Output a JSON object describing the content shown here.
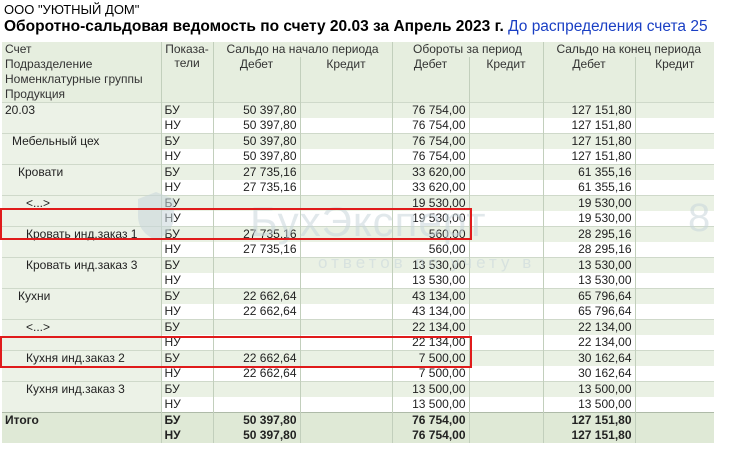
{
  "header": {
    "org": "ООО \"УЮТНЫЙ ДОМ\"",
    "title": "Оборотно-сальдовая ведомость по счету 20.03 за Апрель 2023 г.",
    "link": "До распределения счета 25"
  },
  "columns": {
    "left": [
      "Счет",
      "Подразделение",
      "Номенклатурные группы",
      "Продукция"
    ],
    "pokazateli": "Показа-\nтели",
    "saldo_start": "Сальдо на начало периода",
    "turnover": "Обороты за период",
    "saldo_end": "Сальдо на конец периода",
    "debet": "Дебет",
    "kredit": "Кредит"
  },
  "rows": [
    {
      "name": "20.03",
      "indent": 0,
      "bu": {
        "sd": "50 397,80",
        "od": "76 754,00",
        "ed": "127 151,80"
      },
      "nu": {
        "sd": "50 397,80",
        "od": "76 754,00",
        "ed": "127 151,80"
      }
    },
    {
      "name": "Мебельный цех",
      "indent": 1,
      "bu": {
        "sd": "50 397,80",
        "od": "76 754,00",
        "ed": "127 151,80"
      },
      "nu": {
        "sd": "50 397,80",
        "od": "76 754,00",
        "ed": "127 151,80"
      }
    },
    {
      "name": "Кровати",
      "indent": 2,
      "bu": {
        "sd": "27 735,16",
        "od": "33 620,00",
        "ed": "61 355,16"
      },
      "nu": {
        "sd": "27 735,16",
        "od": "33 620,00",
        "ed": "61 355,16"
      }
    },
    {
      "name": "<...>",
      "indent": 3,
      "bu": {
        "sd": "",
        "od": "19 530,00",
        "ed": "19 530,00"
      },
      "nu": {
        "sd": "",
        "od": "19 530,00",
        "ed": "19 530,00"
      }
    },
    {
      "name": "Кровать инд.заказ 1",
      "indent": 3,
      "bu": {
        "sd": "27 735,16",
        "od": "560,00",
        "ed": "28 295,16"
      },
      "nu": {
        "sd": "27 735,16",
        "od": "560,00",
        "ed": "28 295,16"
      }
    },
    {
      "name": "Кровать инд.заказ 3",
      "indent": 3,
      "bu": {
        "sd": "",
        "od": "13 530,00",
        "ed": "13 530,00"
      },
      "nu": {
        "sd": "",
        "od": "13 530,00",
        "ed": "13 530,00"
      }
    },
    {
      "name": "Кухни",
      "indent": 2,
      "bu": {
        "sd": "22 662,64",
        "od": "43 134,00",
        "ed": "65 796,64"
      },
      "nu": {
        "sd": "22 662,64",
        "od": "43 134,00",
        "ed": "65 796,64"
      }
    },
    {
      "name": "<...>",
      "indent": 3,
      "bu": {
        "sd": "",
        "od": "22 134,00",
        "ed": "22 134,00"
      },
      "nu": {
        "sd": "",
        "od": "22 134,00",
        "ed": "22 134,00"
      }
    },
    {
      "name": "Кухня инд.заказ 2",
      "indent": 3,
      "bu": {
        "sd": "22 662,64",
        "od": "7 500,00",
        "ed": "30 162,64"
      },
      "nu": {
        "sd": "22 662,64",
        "od": "7 500,00",
        "ed": "30 162,64"
      }
    },
    {
      "name": "Кухня инд.заказ 3",
      "indent": 3,
      "bu": {
        "sd": "",
        "od": "13 500,00",
        "ed": "13 500,00"
      },
      "nu": {
        "sd": "",
        "od": "13 500,00",
        "ed": "13 500,00"
      }
    }
  ],
  "total": {
    "label": "Итого",
    "bu": {
      "sd": "50 397,80",
      "od": "76 754,00",
      "ed": "127 151,80"
    },
    "nu": {
      "sd": "50 397,80",
      "od": "76 754,00",
      "ed": "127 151,80"
    }
  },
  "indicators": {
    "bu": "БУ",
    "nu": "НУ"
  },
  "watermark": {
    "text": "БухЭксперт",
    "sub": "ответов по учету в",
    "num": "8"
  },
  "colors": {
    "highlight": "#e01b1b",
    "link": "#1a3fc4",
    "header_bg": "#e6eedf",
    "group_bg": "#eaf1e4",
    "total_bg": "#dfe9d6"
  }
}
